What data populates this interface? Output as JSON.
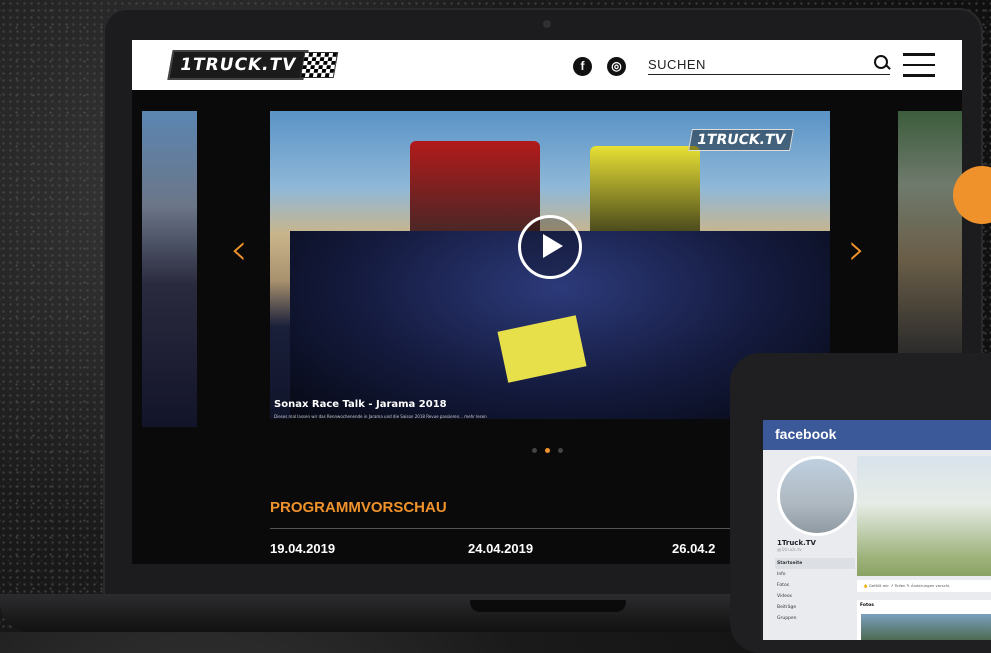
{
  "site": {
    "logo_text": "1TRUCK.TV",
    "search_placeholder": "SUCHEN"
  },
  "social": {
    "facebook_glyph": "f",
    "instagram_glyph": "◎"
  },
  "slider": {
    "watermark": "1TRUCK.TV",
    "caption_title": "Sonax Race Talk - Jarama 2018",
    "caption_text": "Dieses mal lassen wir das Rennwochenende in Jarama und die Saison 2018 Revue passieren... mehr lesen",
    "prev_arrow": "‹",
    "next_arrow": "›",
    "dot_count": 3,
    "active_dot": 2
  },
  "programm": {
    "heading": "PROGRAMMVORSCHAU",
    "dates": [
      "19.04.2019",
      "24.04.2019",
      "26.04.2"
    ]
  },
  "facebook": {
    "brand": "facebook",
    "page_name": "1Truck.TV",
    "handle": "@1truck.tv",
    "nav": [
      "Startseite",
      "Info",
      "Fotos",
      "Videos",
      "Beiträge",
      "Gruppen"
    ],
    "active_nav": "Startseite",
    "actions": "👍 Gefällt mir   ↗ Teilen   ✎ Änderungen vorschl.",
    "fotos_label": "Fotos"
  },
  "colors": {
    "accent": "#f0922b",
    "facebook_blue": "#3b5998"
  }
}
